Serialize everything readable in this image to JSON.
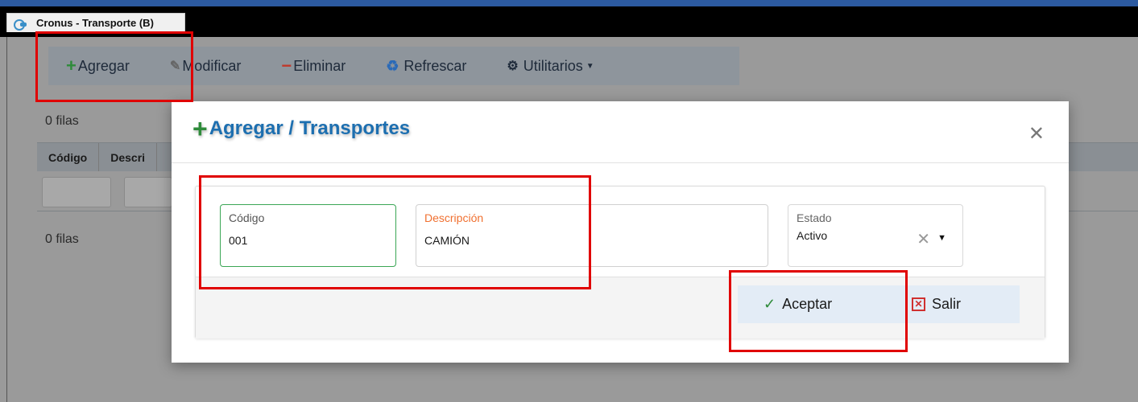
{
  "window": {
    "title": "Cronus - Transporte (B)"
  },
  "toolbar": {
    "add_label": "Agregar",
    "edit_label": "Modificar",
    "delete_label": "Eliminar",
    "refresh_label": "Refrescar",
    "utilities_label": "Utilitarios"
  },
  "grid": {
    "rows_top": "0 filas",
    "rows_bottom": "0 filas",
    "columns": [
      "Código",
      "Descri"
    ]
  },
  "modal": {
    "title": "Agregar / Transportes",
    "fields": {
      "codigo_label": "Código",
      "codigo_value": "001",
      "descripcion_label": "Descripción",
      "descripcion_value": "CAMIÓN",
      "estado_label": "Estado",
      "estado_value": "Activo"
    },
    "accept_label": "Aceptar",
    "exit_label": "Salir"
  },
  "colors": {
    "highlight": "#e00000",
    "title_blue": "#1d6fb0",
    "valid_green": "#3aa655",
    "required_orange": "#f07030"
  },
  "icons": [
    "plus-icon",
    "pencil-icon",
    "minus-icon",
    "refresh-icon",
    "gears-icon",
    "close-icon",
    "check-icon",
    "close-box-icon"
  ]
}
